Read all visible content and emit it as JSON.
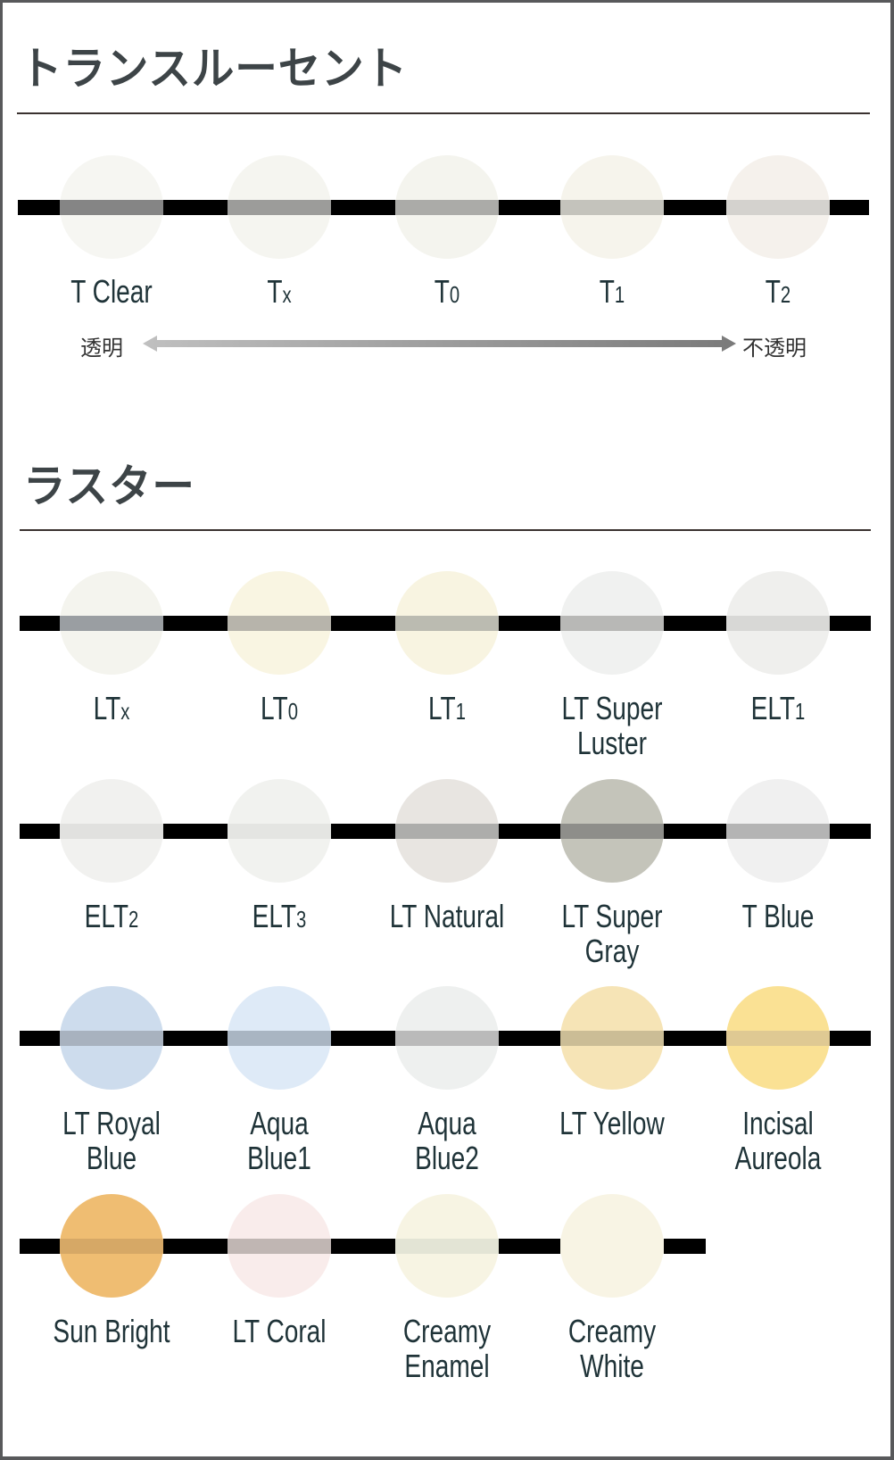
{
  "translucent": {
    "title": "トランスルーセント",
    "items": [
      {
        "name": "T Clear",
        "main": "T Clear",
        "sub": "",
        "fill": "#f6f6f2",
        "band": "#858585"
      },
      {
        "name": "Tx",
        "main": "T",
        "sub": "x",
        "fill": "#f5f5f0",
        "band": "#9c9c9a"
      },
      {
        "name": "T0",
        "main": "T",
        "sub": "0",
        "fill": "#f4f4ee",
        "band": "#ababa8"
      },
      {
        "name": "T1",
        "main": "T",
        "sub": "1",
        "fill": "#f6f4ec",
        "band": "#c4c3bc"
      },
      {
        "name": "T2",
        "main": "T",
        "sub": "2",
        "fill": "#f5f1ec",
        "band": "#d4d2ce"
      }
    ],
    "scale": {
      "left": "透明",
      "right": "不透明"
    }
  },
  "luster": {
    "title": "ラスター",
    "rows": [
      [
        {
          "name": "LTx",
          "main": "LT",
          "sub": "x",
          "fill": "#f4f4ee",
          "band": "#9a9ea2"
        },
        {
          "name": "LT0",
          "main": "LT",
          "sub": "0",
          "fill": "#f9f5e2",
          "band": "#b7b4ab"
        },
        {
          "name": "LT1",
          "main": "LT",
          "sub": "1",
          "fill": "#f8f4e1",
          "band": "#bbbbb1"
        },
        {
          "name": "LT Super Luster",
          "main": "LT Super Luster",
          "sub": "",
          "fill": "#f0f1f0",
          "band": "#b8b8b6"
        },
        {
          "name": "ELT1",
          "main": "ELT",
          "sub": "1",
          "fill": "#efefed",
          "band": "#d8d8d6"
        }
      ],
      [
        {
          "name": "ELT2",
          "main": "ELT",
          "sub": "2",
          "fill": "#f1f1ef",
          "band": "#e1e1df"
        },
        {
          "name": "ELT3",
          "main": "ELT",
          "sub": "3",
          "fill": "#f1f2ef",
          "band": "#e4e5e2"
        },
        {
          "name": "LT Natural",
          "main": "LT Natural",
          "sub": "",
          "fill": "#e8e5e1",
          "band": "#adadab"
        },
        {
          "name": "LT Super Gray",
          "main": "LT Super Gray",
          "sub": "",
          "fill": "#c4c4ba",
          "band": "#8e8e8a"
        },
        {
          "name": "T Blue",
          "main": "T Blue",
          "sub": "",
          "fill": "#f0f0f0",
          "band": "#b4b4b4"
        }
      ],
      [
        {
          "name": "LT Royal Blue",
          "main": "LT Royal Blue",
          "sub": "",
          "fill": "#cddced",
          "band": "#a8b2bf"
        },
        {
          "name": "Aqua Blue1",
          "main": "Aqua Blue1",
          "sub": "",
          "fill": "#deeaf7",
          "band": "#a9b5c2"
        },
        {
          "name": "Aqua Blue2",
          "main": "Aqua Blue2",
          "sub": "",
          "fill": "#eef0ef",
          "band": "#bababa"
        },
        {
          "name": "LT Yellow",
          "main": "LT Yellow",
          "sub": "",
          "fill": "#f6e4b6",
          "band": "#cbbd96"
        },
        {
          "name": "Incisal Aureola",
          "main": "Incisal\nAureola",
          "sub": "",
          "fill": "#fae194",
          "band": "#dfc993"
        }
      ],
      [
        {
          "name": "Sun Bright",
          "main": "Sun Bright",
          "sub": "",
          "fill": "#efbd72",
          "band": "#d6a866"
        },
        {
          "name": "LT Coral",
          "main": "LT Coral",
          "sub": "",
          "fill": "#f9eceb",
          "band": "#c0b6b3"
        },
        {
          "name": "Creamy Enamel",
          "main": "Creamy\nEnamel",
          "sub": "",
          "fill": "#f7f4e3",
          "band": "#e3e4d5"
        },
        {
          "name": "Creamy White",
          "main": "Creamy\nWhite",
          "sub": "",
          "fill": "#f8f4e4",
          "band": "#f8f4e4"
        }
      ]
    ]
  }
}
